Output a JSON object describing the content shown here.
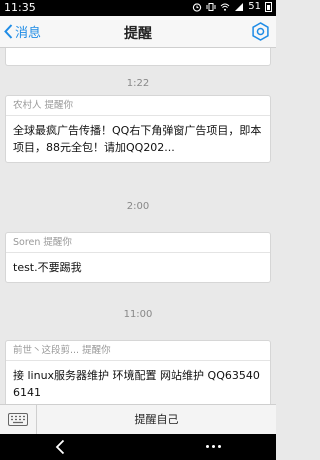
{
  "status_bar": {
    "time": "11:35",
    "battery_level": "51"
  },
  "nav": {
    "back_label": "消息",
    "title": "提醒"
  },
  "timestamps": [
    "1:22",
    "2:00",
    "11:00"
  ],
  "messages": [
    {
      "header": "农村人 提醒你",
      "text": "全球最疯广告传播！QQ右下角弹窗广告项目，即本项目，88元全包！请加QQ202..."
    },
    {
      "header": "Soren 提醒你",
      "text": "test.不要踢我"
    },
    {
      "header": "前世丶这段剪... 提醒你",
      "text": "接 linux服务器维护 环境配置 网站维护 QQ635406141"
    }
  ],
  "input_bar": {
    "self_remind_label": "提醒自己"
  },
  "icons": {
    "back": "chevron-left-icon",
    "settings": "gear-icon",
    "keyboard": "keyboard-icon",
    "system_back": "system-back-icon",
    "system_more": "more-icon"
  },
  "colors": {
    "accent": "#1f8ce6",
    "background": "#e9e9e9"
  }
}
